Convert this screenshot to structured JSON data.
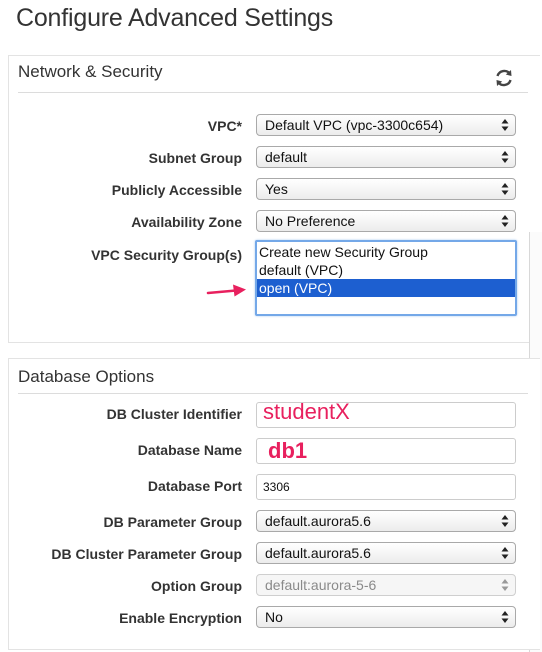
{
  "page_title": "Configure Advanced Settings",
  "network": {
    "header": "Network & Security",
    "rows": {
      "vpc": {
        "label": "VPC*",
        "value": "Default VPC (vpc-3300c654)"
      },
      "subnet": {
        "label": "Subnet Group",
        "value": "default"
      },
      "public": {
        "label": "Publicly Accessible",
        "value": "Yes"
      },
      "az": {
        "label": "Availability Zone",
        "value": "No Preference"
      }
    },
    "sg": {
      "label": "VPC Security Group(s)",
      "options": [
        "Create new Security Group",
        "default (VPC)",
        "open (VPC)"
      ],
      "selected": "open (VPC)"
    }
  },
  "db": {
    "header": "Database Options",
    "cluster_id": {
      "label": "DB Cluster Identifier",
      "annotation": "studentX"
    },
    "db_name": {
      "label": "Database Name",
      "annotation": "db1"
    },
    "port": {
      "label": "Database Port",
      "value": "3306"
    },
    "param_group": {
      "label": "DB Parameter Group",
      "value": "default.aurora5.6"
    },
    "cluster_param_group": {
      "label": "DB Cluster Parameter Group",
      "value": "default.aurora5.6"
    },
    "option_group": {
      "label": "Option Group",
      "value": "default:aurora-5-6"
    },
    "encryption": {
      "label": "Enable Encryption",
      "value": "No"
    }
  },
  "colors": {
    "annotation": "#e8205e",
    "selection": "#1d5fd0",
    "focus_border": "#74a8e8"
  },
  "icons": {
    "refresh": "refresh-icon",
    "select_arrows": "updown-arrows-icon"
  }
}
